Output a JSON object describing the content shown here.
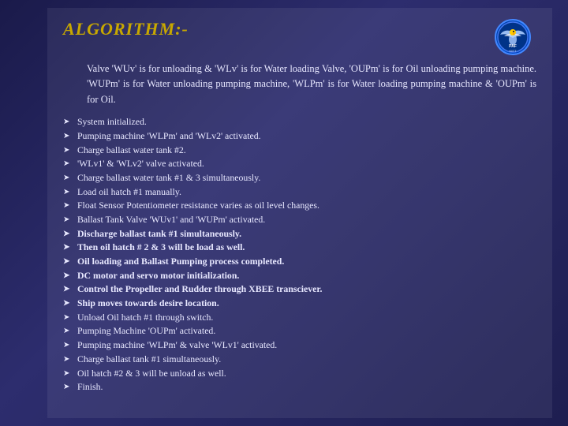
{
  "header": {
    "title": "ALGORITHM:-",
    "logo": {
      "line1": "PAF",
      "line2": "KIET",
      "label": ""
    }
  },
  "intro": {
    "text": "Valve 'WUv' is for unloading & 'WLv' is for Water loading Valve, 'OUPm' is for Oil unloading pumping machine. 'WUPm' is for Water unloading pumping machine, 'WLPm' is for Water loading pumping machine & 'OUPm' is for Oil."
  },
  "bullets": [
    "System initialized.",
    "Pumping machine 'WLPm' and 'WLv2' activated.",
    "Charge ballast water tank #2.",
    "'WLv1' & 'WLv2' valve activated.",
    "Charge ballast water tank #1 & 3 simultaneously.",
    "Load oil hatch #1 manually.",
    "Float Sensor Potentiometer resistance varies as oil level changes.",
    "Ballast Tank Valve 'WUv1' and 'WUPm' activated.",
    "Discharge ballast tank #1 simultaneously.",
    "Then oil hatch # 2 & 3 will be load as well.",
    "Oil loading and Ballast Pumping process completed.",
    "DC motor and servo motor initialization.",
    "Control the Propeller and Rudder through XBEE transciever.",
    "Ship moves towards desire location.",
    "Unload Oil hatch #1 through switch.",
    "Pumping Machine 'OUPm' activated.",
    "Pumping machine 'WLPm' & valve 'WLv1' activated.",
    "Charge ballast tank #1 simultaneously.",
    "Oil hatch #2 & 3 will be unload as well.",
    "Finish."
  ]
}
